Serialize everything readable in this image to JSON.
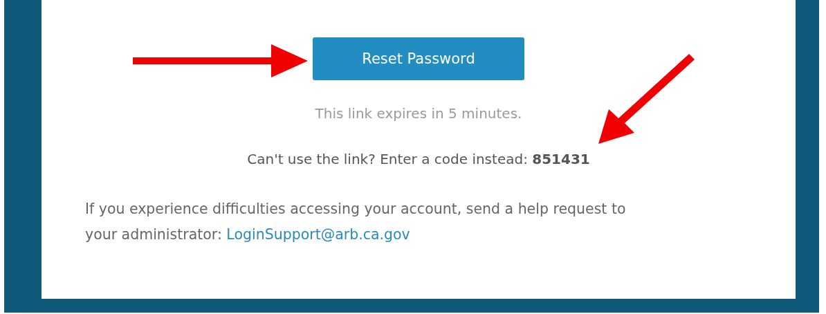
{
  "email": {
    "button": {
      "label": "Reset Password"
    },
    "expiry_note": "This link expires in 5 minutes.",
    "code_line": "Can't use the link? Enter a code instead: **851431**",
    "help": {
      "text": "If you experience difficulties accessing your account, send a help request to your administrator: ",
      "link": "LoginSupport@arb.ca.gov"
    }
  }
}
